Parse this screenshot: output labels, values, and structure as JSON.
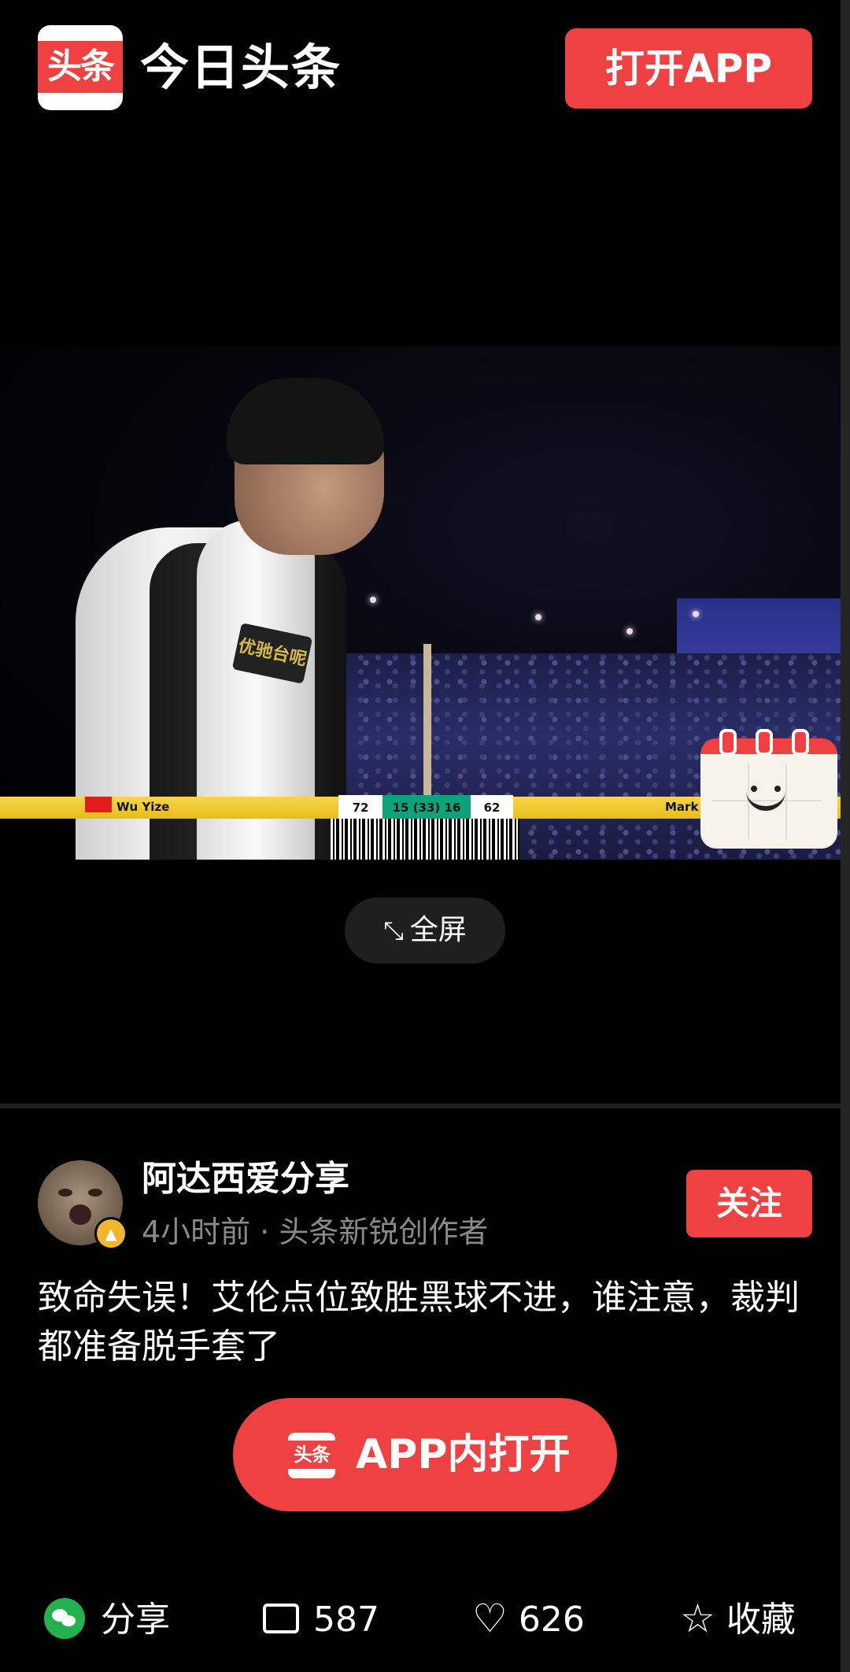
{
  "header": {
    "logo_text": "头条",
    "app_name": "今日头条",
    "open_app_label": "打开APP"
  },
  "video": {
    "scoreboard": {
      "player1": "Wu Yize",
      "player1_score": "72",
      "frames": "15 (33) 16",
      "player2_score": "62",
      "player2": "Mark Allen"
    },
    "armband_text": "优驰台呢",
    "fullscreen_label": "全屏"
  },
  "author": {
    "name": "阿达西爱分享",
    "meta": "4小时前 · 头条新锐创作者",
    "follow_label": "关注"
  },
  "article": {
    "title": "致命失误！艾伦点位致胜黑球不进，谁注意，裁判都准备脱手套了"
  },
  "cta": {
    "logo_text": "头条",
    "label": "APP内打开"
  },
  "bottom_bar": {
    "share_label": "分享",
    "comment_count": "587",
    "like_count": "626",
    "collect_label": "收藏"
  },
  "colors": {
    "brand_red": "#f04142",
    "background": "#000000",
    "wechat_green": "#22b14c"
  },
  "icons": [
    "fullscreen-icon",
    "calendar-smile-icon",
    "wechat-icon",
    "comment-icon",
    "heart-icon",
    "star-icon"
  ]
}
